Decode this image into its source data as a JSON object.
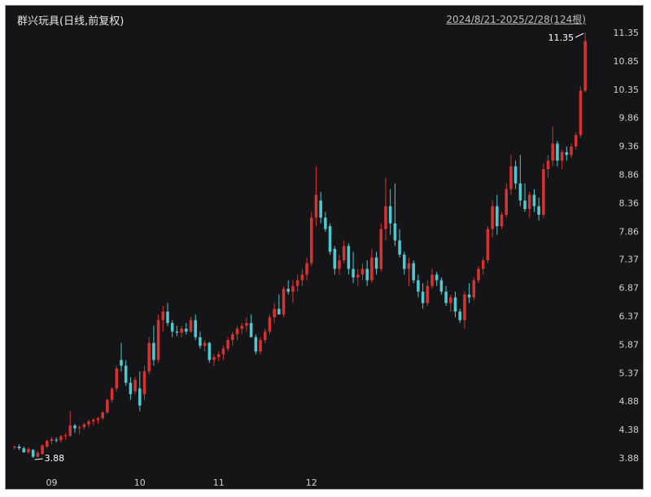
{
  "header": {
    "stock_title": "群兴玩具(日线,前复权)",
    "date_range": "2024/8/21-2025/2/28(124根)"
  },
  "chart_data": {
    "type": "candlestick",
    "title": "群兴玩具(日线,前复权)",
    "period": "2024/8/21-2025/2/28",
    "bar_count": "124根",
    "y_ticks": [
      "11.35",
      "10.85",
      "10.35",
      "9.86",
      "9.36",
      "8.86",
      "8.36",
      "7.86",
      "7.37",
      "6.87",
      "6.37",
      "5.87",
      "5.37",
      "4.88",
      "4.38",
      "3.88"
    ],
    "ylim": [
      3.88,
      11.35
    ],
    "x_ticks": [
      {
        "label": "09",
        "index": 8
      },
      {
        "label": "10",
        "index": 27
      },
      {
        "label": "11",
        "index": 44
      },
      {
        "label": "12",
        "index": 64
      }
    ],
    "annotations": [
      {
        "text": "3.88",
        "index": 4,
        "value": 3.88,
        "kind": "low"
      },
      {
        "text": "11.35",
        "index": 123,
        "value": 11.35,
        "kind": "high"
      }
    ],
    "colors": {
      "up": "#d73232",
      "down": "#4ec9cf",
      "background": "#151517",
      "text": "#cfcfcf"
    },
    "candles": [
      [
        4.08,
        4.1,
        4.03,
        4.08
      ],
      [
        4.08,
        4.12,
        4.02,
        4.05
      ],
      [
        4.05,
        4.08,
        3.97,
        3.98
      ],
      [
        3.98,
        4.06,
        3.95,
        4.04
      ],
      [
        4.02,
        4.04,
        3.88,
        3.9
      ],
      [
        3.9,
        4.0,
        3.89,
        3.97
      ],
      [
        3.95,
        4.12,
        3.93,
        4.1
      ],
      [
        4.08,
        4.2,
        4.05,
        4.18
      ],
      [
        4.18,
        4.25,
        4.12,
        4.21
      ],
      [
        4.2,
        4.24,
        4.15,
        4.19
      ],
      [
        4.19,
        4.28,
        4.15,
        4.26
      ],
      [
        4.26,
        4.32,
        4.2,
        4.28
      ],
      [
        4.27,
        4.7,
        4.25,
        4.45
      ],
      [
        4.45,
        4.48,
        4.32,
        4.4
      ],
      [
        4.4,
        4.45,
        4.3,
        4.42
      ],
      [
        4.42,
        4.5,
        4.38,
        4.47
      ],
      [
        4.47,
        4.55,
        4.42,
        4.52
      ],
      [
        4.52,
        4.58,
        4.45,
        4.55
      ],
      [
        4.55,
        4.6,
        4.48,
        4.58
      ],
      [
        4.58,
        4.7,
        4.55,
        4.68
      ],
      [
        4.68,
        4.92,
        4.65,
        4.9
      ],
      [
        4.9,
        5.12,
        4.85,
        5.1
      ],
      [
        5.1,
        5.5,
        5.05,
        5.45
      ],
      [
        5.6,
        5.9,
        5.4,
        5.5
      ],
      [
        5.5,
        5.6,
        5.15,
        5.2
      ],
      [
        5.2,
        5.3,
        4.9,
        5.0
      ],
      [
        5.05,
        5.3,
        5.0,
        5.25
      ],
      [
        5.1,
        5.4,
        4.7,
        4.8
      ],
      [
        5.0,
        5.5,
        4.9,
        5.4
      ],
      [
        5.4,
        6.0,
        5.35,
        5.9
      ],
      [
        5.9,
        6.2,
        5.5,
        5.6
      ],
      [
        5.6,
        6.4,
        5.55,
        6.3
      ],
      [
        6.3,
        6.55,
        6.1,
        6.45
      ],
      [
        6.45,
        6.6,
        6.2,
        6.25
      ],
      [
        6.25,
        6.3,
        6.0,
        6.1
      ],
      [
        6.1,
        6.2,
        6.02,
        6.08
      ],
      [
        6.08,
        6.2,
        6.0,
        6.15
      ],
      [
        6.15,
        6.25,
        6.05,
        6.1
      ],
      [
        6.1,
        6.35,
        6.08,
        6.3
      ],
      [
        6.3,
        6.4,
        5.95,
        6.0
      ],
      [
        6.0,
        6.1,
        5.8,
        5.85
      ],
      [
        5.85,
        5.95,
        5.75,
        5.9
      ],
      [
        5.9,
        5.92,
        5.55,
        5.6
      ],
      [
        5.6,
        5.7,
        5.5,
        5.65
      ],
      [
        5.65,
        5.75,
        5.58,
        5.7
      ],
      [
        5.7,
        5.85,
        5.6,
        5.8
      ],
      [
        5.8,
        6.0,
        5.75,
        5.95
      ],
      [
        5.95,
        6.1,
        5.85,
        6.05
      ],
      [
        6.05,
        6.2,
        5.95,
        6.15
      ],
      [
        6.15,
        6.25,
        6.05,
        6.2
      ],
      [
        6.2,
        6.35,
        6.1,
        6.25
      ],
      [
        6.25,
        6.4,
        6.15,
        6.0
      ],
      [
        6.0,
        6.05,
        5.7,
        5.75
      ],
      [
        5.75,
        6.0,
        5.7,
        5.95
      ],
      [
        5.95,
        6.15,
        5.9,
        6.1
      ],
      [
        6.1,
        6.4,
        6.05,
        6.35
      ],
      [
        6.35,
        6.6,
        6.25,
        6.5
      ],
      [
        6.5,
        6.75,
        6.4,
        6.4
      ],
      [
        6.4,
        6.9,
        6.35,
        6.85
      ],
      [
        6.85,
        7.0,
        6.75,
        6.8
      ],
      [
        6.8,
        7.0,
        6.6,
        6.9
      ],
      [
        6.9,
        7.1,
        6.8,
        7.0
      ],
      [
        7.0,
        7.2,
        6.9,
        7.1
      ],
      [
        7.1,
        7.4,
        7.0,
        7.3
      ],
      [
        7.3,
        8.2,
        7.25,
        8.1
      ],
      [
        8.1,
        9.0,
        7.95,
        8.5
      ],
      [
        8.4,
        8.55,
        8.0,
        8.1
      ],
      [
        8.1,
        8.2,
        7.85,
        7.9
      ],
      [
        7.95,
        8.0,
        7.45,
        7.5
      ],
      [
        7.55,
        7.6,
        7.1,
        7.2
      ],
      [
        7.2,
        7.45,
        7.1,
        7.35
      ],
      [
        7.35,
        7.7,
        7.3,
        7.6
      ],
      [
        7.6,
        7.65,
        7.1,
        7.2
      ],
      [
        7.2,
        7.5,
        6.95,
        7.05
      ],
      [
        7.05,
        7.2,
        6.9,
        7.1
      ],
      [
        7.1,
        7.3,
        7.0,
        7.2
      ],
      [
        7.2,
        7.35,
        6.9,
        7.0
      ],
      [
        7.0,
        7.55,
        6.95,
        7.4
      ],
      [
        7.4,
        7.5,
        7.1,
        7.2
      ],
      [
        7.2,
        8.0,
        7.15,
        7.9
      ],
      [
        7.9,
        8.8,
        7.7,
        8.3
      ],
      [
        8.3,
        8.6,
        7.8,
        8.0
      ],
      [
        8.0,
        8.7,
        7.6,
        7.7
      ],
      [
        7.7,
        7.9,
        7.4,
        7.45
      ],
      [
        7.45,
        7.5,
        7.1,
        7.2
      ],
      [
        7.2,
        7.4,
        6.9,
        7.3
      ],
      [
        7.3,
        7.35,
        6.95,
        7.0
      ],
      [
        7.0,
        7.1,
        6.7,
        6.8
      ],
      [
        6.8,
        6.95,
        6.5,
        6.6
      ],
      [
        6.6,
        7.0,
        6.55,
        6.9
      ],
      [
        6.9,
        7.2,
        6.85,
        7.1
      ],
      [
        7.1,
        7.15,
        6.9,
        7.0
      ],
      [
        7.0,
        7.05,
        6.75,
        6.8
      ],
      [
        6.8,
        6.9,
        6.55,
        6.6
      ],
      [
        6.6,
        6.75,
        6.45,
        6.7
      ],
      [
        6.7,
        6.8,
        6.35,
        6.45
      ],
      [
        6.45,
        6.5,
        6.25,
        6.3
      ],
      [
        6.3,
        6.8,
        6.15,
        6.75
      ],
      [
        6.75,
        6.95,
        6.6,
        6.7
      ],
      [
        6.7,
        7.05,
        6.65,
        7.0
      ],
      [
        7.0,
        7.25,
        6.95,
        7.2
      ],
      [
        7.2,
        7.4,
        7.1,
        7.35
      ],
      [
        7.35,
        7.95,
        7.3,
        7.9
      ],
      [
        7.9,
        8.4,
        7.75,
        8.3
      ],
      [
        8.3,
        8.5,
        7.8,
        7.95
      ],
      [
        7.95,
        8.2,
        7.9,
        8.15
      ],
      [
        8.15,
        8.7,
        8.1,
        8.6
      ],
      [
        8.6,
        9.2,
        8.5,
        9.0
      ],
      [
        9.0,
        9.1,
        8.6,
        8.7
      ],
      [
        8.7,
        9.2,
        8.3,
        8.4
      ],
      [
        8.4,
        8.7,
        8.2,
        8.25
      ],
      [
        8.25,
        8.55,
        8.1,
        8.5
      ],
      [
        8.5,
        8.6,
        8.2,
        8.3
      ],
      [
        8.3,
        8.45,
        8.05,
        8.15
      ],
      [
        8.15,
        9.05,
        8.1,
        8.95
      ],
      [
        8.95,
        9.2,
        8.8,
        9.1
      ],
      [
        9.1,
        9.7,
        9.0,
        9.4
      ],
      [
        9.4,
        9.45,
        9.0,
        9.1
      ],
      [
        9.1,
        9.3,
        8.95,
        9.25
      ],
      [
        9.25,
        9.35,
        9.1,
        9.2
      ],
      [
        9.2,
        9.4,
        9.15,
        9.35
      ],
      [
        9.35,
        9.6,
        9.3,
        9.55
      ],
      [
        9.55,
        10.4,
        9.5,
        10.33
      ],
      [
        10.33,
        11.35,
        10.3,
        11.2
      ]
    ]
  }
}
